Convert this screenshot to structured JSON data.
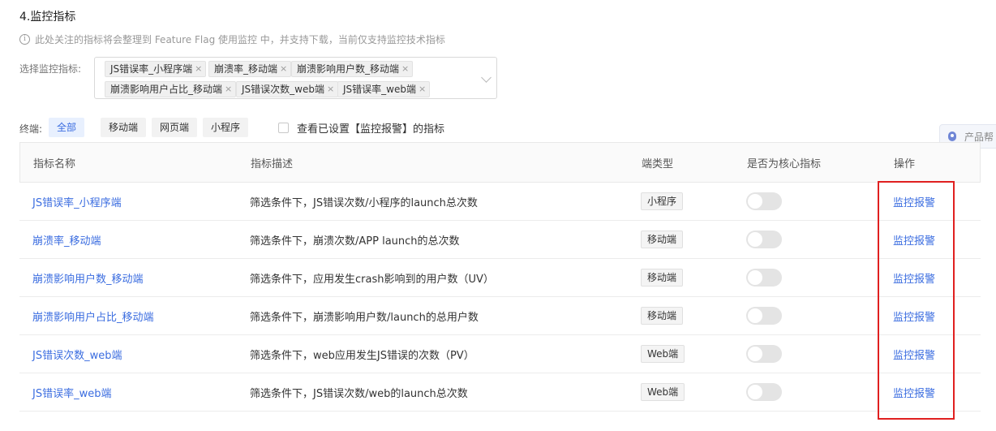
{
  "section": {
    "title": "4.监控指标",
    "tip": "此处关注的指标将会整理到 Feature Flag 使用监控 中，并支持下载，当前仅支持监控技术指标",
    "tip_icon": "info-icon"
  },
  "selector": {
    "label": "选择监控指标:",
    "tags": [
      "JS错误率_小程序端",
      "崩溃率_移动端",
      "崩溃影响用户数_移动端",
      "崩溃影响用户占比_移动端",
      "JS错误次数_web端",
      "JS错误率_web端"
    ],
    "remove_icon": "×"
  },
  "filter": {
    "label": "终端:",
    "buttons": [
      "全部",
      "移动端",
      "网页端",
      "小程序"
    ],
    "active": "全部",
    "checkbox_label": "查看已设置【监控报警】的指标",
    "checked": false
  },
  "helper": {
    "label": "产品帮"
  },
  "table": {
    "headers": [
      "指标名称",
      "指标描述",
      "端类型",
      "是否为核心指标",
      "操作"
    ],
    "rows": [
      {
        "name": "JS错误率_小程序端",
        "desc": "筛选条件下，JS错误次数/小程序的launch总次数",
        "type": "小程序",
        "core": false,
        "action": "监控报警"
      },
      {
        "name": "崩溃率_移动端",
        "desc": "筛选条件下，崩溃次数/APP launch的总次数",
        "type": "移动端",
        "core": false,
        "action": "监控报警"
      },
      {
        "name": "崩溃影响用户数_移动端",
        "desc": "筛选条件下，应用发生crash影响到的用户数（UV）",
        "type": "移动端",
        "core": false,
        "action": "监控报警"
      },
      {
        "name": "崩溃影响用户占比_移动端",
        "desc": "筛选条件下，崩溃影响用户数/launch的总用户数",
        "type": "移动端",
        "core": false,
        "action": "监控报警"
      },
      {
        "name": "JS错误次数_web端",
        "desc": "筛选条件下，web应用发生JS错误的次数（PV）",
        "type": "Web端",
        "core": false,
        "action": "监控报警"
      },
      {
        "name": "JS错误率_web端",
        "desc": "筛选条件下，JS错误次数/web的launch总次数",
        "type": "Web端",
        "core": false,
        "action": "监控报警"
      }
    ]
  },
  "colors": {
    "link": "#3b6de0",
    "highlight": "#e02020",
    "active_filter_bg": "#e8f0fe"
  }
}
